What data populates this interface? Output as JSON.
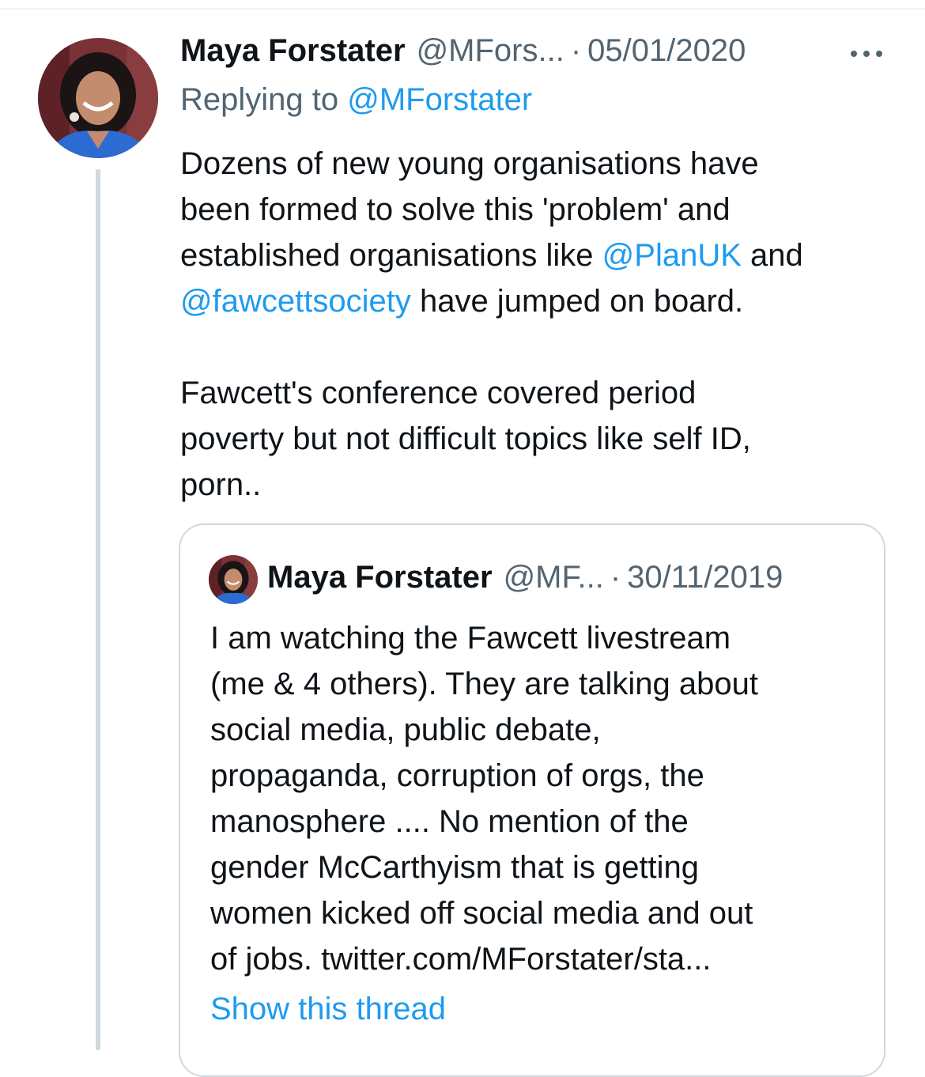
{
  "tweet": {
    "display_name": "Maya Forstater",
    "handle": "@MFors...",
    "separator": "·",
    "date": "05/01/2020",
    "replying_prefix": "Replying to",
    "replying_handle": "@MForstater",
    "text": {
      "l1": "Dozens of new young organisations have",
      "l2": "been formed to solve this 'problem' and",
      "l3_a": "established organisations like",
      "l3_mention": "@PlanUK",
      "l3_b": "and",
      "l4_mention": "@fawcettsociety",
      "l4_b": "have jumped on board.",
      "l5": "Fawcett's conference covered period",
      "l6": "poverty but not difficult topics like self ID,",
      "l7": "porn.."
    }
  },
  "quoted_tweet": {
    "display_name": "Maya Forstater",
    "handle": "@MF...",
    "separator": "·",
    "date": "30/11/2019",
    "lines": [
      "I am watching the Fawcett livestream",
      "(me & 4 others). They are talking about",
      "social media, public debate,",
      "propaganda, corruption of orgs, the",
      "manosphere .... No mention of the",
      "gender McCarthyism that is getting",
      "women kicked off social media and out",
      "of jobs. twitter.com/MForstater/sta..."
    ],
    "show_thread": "Show this thread"
  },
  "icons": {
    "more": "more-horizontal-icon",
    "avatar": "profile-photo"
  },
  "colors": {
    "link": "#1d9bf0",
    "secondary_text": "#536471",
    "border": "#cfd9de"
  }
}
